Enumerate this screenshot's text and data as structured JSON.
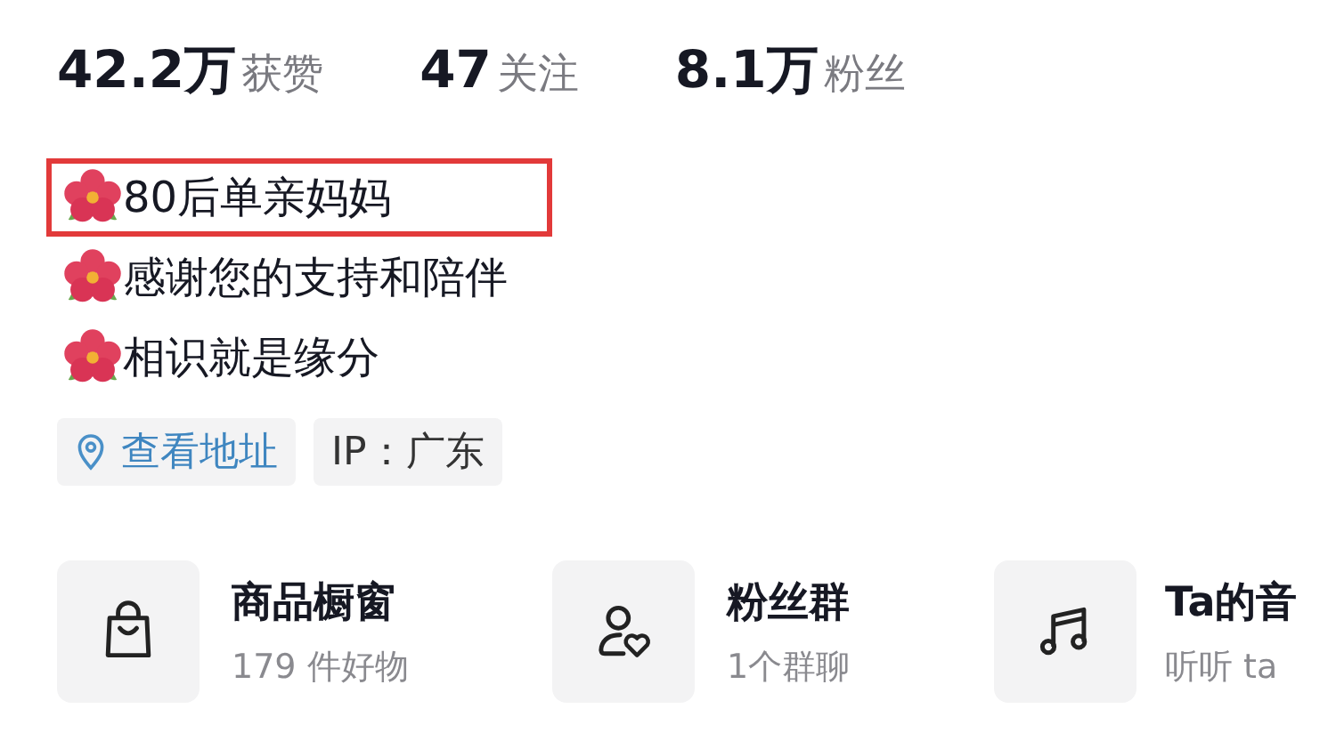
{
  "stats": [
    {
      "value": "42.2万",
      "label": "获赞"
    },
    {
      "value": "47",
      "label": "关注"
    },
    {
      "value": "8.1万",
      "label": "粉丝"
    }
  ],
  "bio": [
    {
      "text": "80后单亲妈妈",
      "highlighted": true
    },
    {
      "text": "感谢您的支持和陪伴",
      "highlighted": false
    },
    {
      "text": "相识就是缘分",
      "highlighted": false
    }
  ],
  "tags": [
    {
      "kind": "location",
      "label": "查看地址"
    },
    {
      "kind": "plain",
      "label": "IP：广东"
    }
  ],
  "cards": [
    {
      "kind": "bag",
      "title": "商品橱窗",
      "subtitle": "179 件好物"
    },
    {
      "kind": "fans",
      "title": "粉丝群",
      "subtitle": "1个群聊"
    },
    {
      "kind": "music",
      "title": "Ta的音",
      "subtitle": "听听 ta"
    }
  ]
}
